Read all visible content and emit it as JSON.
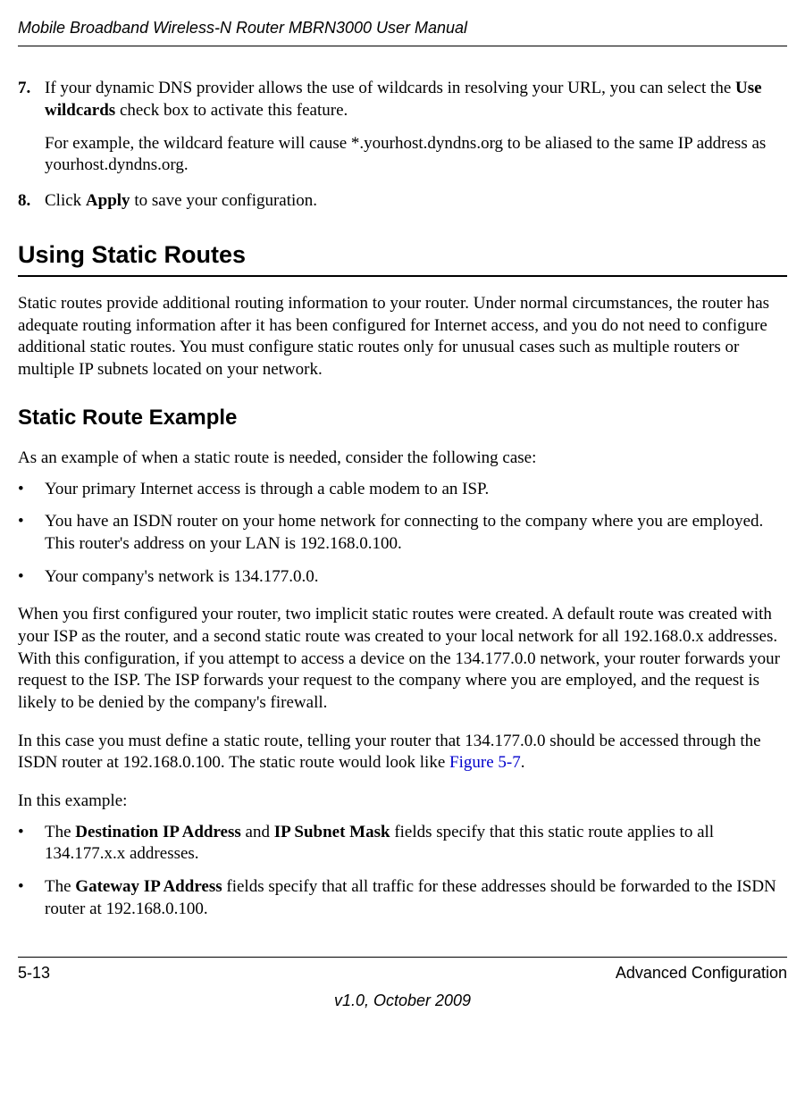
{
  "header": {
    "title": "Mobile Broadband Wireless-N Router MBRN3000 User Manual"
  },
  "step7": {
    "number": "7.",
    "para1_a": "If your dynamic DNS provider allows the use of wildcards in resolving your URL, you can select the ",
    "para1_bold": "Use wildcards",
    "para1_b": " check box to activate this feature.",
    "para2": "For example, the wildcard feature will cause *.yourhost.dyndns.org to be aliased to the same IP address as yourhost.dyndns.org."
  },
  "step8": {
    "number": "8.",
    "para1_a": "Click ",
    "para1_bold": "Apply",
    "para1_b": " to save your configuration."
  },
  "h1": "Using Static Routes",
  "intro_para": "Static routes provide additional routing information to your router. Under normal circumstances, the router has adequate routing information after it has been configured for Internet access, and you do not need to configure additional static routes. You must configure static routes only for unusual cases such as multiple routers or multiple IP subnets located on your network.",
  "h2": "Static Route Example",
  "example_intro": "As an example of when a static route is needed, consider the following case:",
  "bullets1": {
    "b1": "Your primary Internet access is through a cable modem to an ISP.",
    "b2": "You have an ISDN router on your home network for connecting to the company where you are employed. This router's address on your LAN is 192.168.0.100.",
    "b3": "Your company's network is 134.177.0.0."
  },
  "config_para": "When you first configured your router, two implicit static routes were created. A default route was created with your ISP as the router, and a second static route was created to your local network for all 192.168.0.x addresses. With this configuration, if you attempt to access a device on the 134.177.0.0 network, your router forwards your request to the ISP. The ISP forwards your request to the company where you are employed, and the request is likely to be denied by the company's firewall.",
  "static_para_a": "In this case you must define a static route, telling your router that 134.177.0.0 should be accessed through the ISDN router at 192.168.0.100. The static route would look like ",
  "static_para_link": "Figure 5-7",
  "static_para_b": ".",
  "in_example": "In this example:",
  "bullets2": {
    "b1_a": "The ",
    "b1_bold1": "Destination IP Address",
    "b1_mid": " and ",
    "b1_bold2": "IP Subnet Mask",
    "b1_b": " fields specify that this static route applies to all 134.177.x.x addresses.",
    "b2_a": "The ",
    "b2_bold": "Gateway IP Address",
    "b2_b": " fields specify that all traffic for these addresses should be forwarded to the ISDN router at 192.168.0.100."
  },
  "footer": {
    "page": "5-13",
    "section": "Advanced Configuration",
    "version": "v1.0, October 2009"
  }
}
